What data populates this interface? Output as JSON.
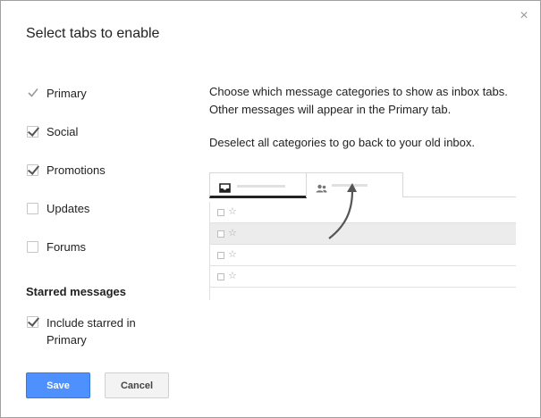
{
  "dialog": {
    "title": "Select tabs to enable",
    "close_label": "×"
  },
  "tabs": [
    {
      "label": "Primary",
      "checked": true,
      "disabled": true
    },
    {
      "label": "Social",
      "checked": true
    },
    {
      "label": "Promotions",
      "checked": true
    },
    {
      "label": "Updates",
      "checked": false
    },
    {
      "label": "Forums",
      "checked": false
    }
  ],
  "starred": {
    "heading": "Starred messages",
    "label": "Include starred in Primary",
    "checked": true
  },
  "description": {
    "line1": "Choose which message categories to show as inbox tabs. Other messages will appear in the Primary tab.",
    "line2": "Deselect all categories to go back to your old inbox."
  },
  "preview": {
    "star_glyph": "☆"
  },
  "buttons": {
    "save": "Save",
    "cancel": "Cancel"
  },
  "colors": {
    "primary_button": "#4d90fe"
  }
}
